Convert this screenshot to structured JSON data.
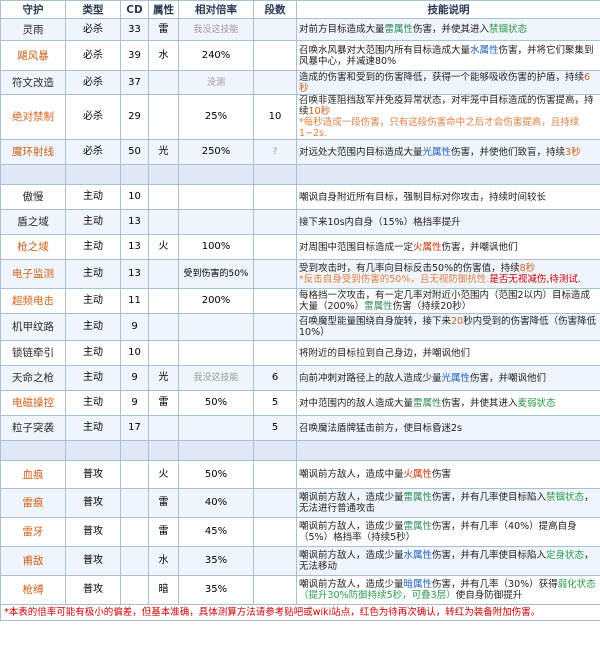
{
  "headers": [
    "守护",
    "类型",
    "CD",
    "属性",
    "相对倍率",
    "段数",
    "技能说明"
  ],
  "rows": {
    "r0": {
      "name": "灵雨",
      "type": "必杀",
      "cd": "33",
      "attr": "雷",
      "rate": "我没这技能",
      "hits": "",
      "d1": "对前方目标造成大量",
      "d2": "雷属性",
      "d3": "伤害，并使其进入",
      "d4": "禁锢状态"
    },
    "r1": {
      "name": "飓风暴",
      "type": "必杀",
      "cd": "39",
      "attr": "水",
      "rate": "240%",
      "hits": "",
      "d1": "召唤水风暴对大范围内所有目标造成大量",
      "d2": "水属性",
      "d3": "伤害，并将它们聚集到风暴中心，并减速80%"
    },
    "r2": {
      "name": "符文改造",
      "type": "必杀",
      "cd": "37",
      "attr": "",
      "rate": "没测",
      "hits": "",
      "d1": "造成的伤害和受到的伤害降低，获得一个能够吸收伤害的护盾，持续",
      "d2": "6秒"
    },
    "r3": {
      "name": "绝对禁制",
      "type": "必杀",
      "cd": "29",
      "attr": "",
      "rate": "25%",
      "hits": "10",
      "d1": "召唤非莲阻挡敌军并免疫异常状态，对牢笼中目标造成的伤害提高，持续",
      "d2": "10秒",
      "d3": "*每秒造成一段伤害，只有这段伤害命中之后才会伤害提高，且持续1~2s."
    },
    "r4": {
      "name": "魔环射线",
      "type": "必杀",
      "cd": "50",
      "attr": "光",
      "rate": "250%",
      "hits": "?",
      "d1": "对远处大范围内目标造成大量",
      "d2": "光属性",
      "d3": "伤害，并使他们致盲，持续",
      "d4": "3秒"
    },
    "r5": {
      "name": "傲慢",
      "type": "主动",
      "cd": "10",
      "attr": "",
      "rate": "",
      "hits": "",
      "d1": "嘲讽自身附近所有目标，强制目标对你攻击，持续时间较长"
    },
    "r6": {
      "name": "盾之域",
      "type": "主动",
      "cd": "13",
      "attr": "",
      "rate": "",
      "hits": "",
      "d1": "接下来10s内自身（15%）格挡率提升"
    },
    "r7": {
      "name": "枪之域",
      "type": "主动",
      "cd": "13",
      "attr": "火",
      "rate": "100%",
      "hits": "",
      "d1": "对周围中范围目标造成一定",
      "d2": "火属性",
      "d3": "伤害，并嘲讽他们"
    },
    "r8": {
      "name": "电子监测",
      "type": "主动",
      "cd": "13",
      "attr": "",
      "rate": "受到伤害的50%",
      "hits": "",
      "d1": "受到攻击时，有几率向目标反击50%的伤害值，持续",
      "d2": "8秒",
      "d3": "*反击自身受到伤害的50%，且无视防御抗性.",
      "d4": "是否无视减伤,待测试."
    },
    "r9": {
      "name": "超频电击",
      "type": "主动",
      "cd": "11",
      "attr": "",
      "rate": "200%",
      "hits": "",
      "d1": "每格挡一次攻击，有一定几率对附近小范围内（范围2以内）目标造成大量（200%）",
      "d2": "雷属性",
      "d3": "伤害（持续20秒）"
    },
    "r10": {
      "name": "机甲纹路",
      "type": "主动",
      "cd": "9",
      "attr": "",
      "rate": "",
      "hits": "",
      "d1": "召唤魔型能量围绕自身旋转，接下来",
      "d2": "20",
      "d3": "秒内受到的伤害降低（伤害降低10%）"
    },
    "r11": {
      "name": "锁链牵引",
      "type": "主动",
      "cd": "10",
      "attr": "",
      "rate": "",
      "hits": "",
      "d1": "将附近的目标拉到自己身边，并嘲讽他们"
    },
    "r12": {
      "name": "天命之枪",
      "type": "主动",
      "cd": "9",
      "attr": "光",
      "rate": "我没这技能",
      "hits": "6",
      "d1": "向前冲刺对路径上的敌人造成少量",
      "d2": "光属性",
      "d3": "伤害，并嘲讽他们"
    },
    "r13": {
      "name": "电磁操控",
      "type": "主动",
      "cd": "9",
      "attr": "雷",
      "rate": "50%",
      "hits": "5",
      "d1": "对中范围内的敌人造成大量",
      "d2": "雷属性",
      "d3": "伤害，并使其进入",
      "d4": "麦弱状态"
    },
    "r14": {
      "name": "粒子突袭",
      "type": "主动",
      "cd": "17",
      "attr": "",
      "rate": "",
      "hits": "5",
      "d1": "召唤魔法盾牌猛击前方，使目标昏迷2s"
    },
    "r15": {
      "name": "血痕",
      "type": "普攻",
      "cd": "",
      "attr": "火",
      "rate": "50%",
      "hits": "",
      "d1": "嘲讽前方敌人，造成中量",
      "d2": "火属性",
      "d3": "伤害"
    },
    "r16": {
      "name": "雷痕",
      "type": "普攻",
      "cd": "",
      "attr": "雷",
      "rate": "40%",
      "hits": "",
      "d1": "嘲讽前方敌人，造成少量",
      "d2": "雷属性",
      "d3": "伤害，并有几率使目标陷入",
      "d4": "禁锢状态",
      "d5": "，无法进行普通攻击"
    },
    "r17": {
      "name": "雷牙",
      "type": "普攻",
      "cd": "",
      "attr": "雷",
      "rate": "45%",
      "hits": "",
      "d1": "嘲讽前方敌人，造成少量",
      "d2": "雷属性",
      "d3": "伤害，并有几率（40%）提高自身（5%）格挡率（持续5秒）"
    },
    "r18": {
      "name": "甫敌",
      "type": "普攻",
      "cd": "",
      "attr": "水",
      "rate": "35%",
      "hits": "",
      "d1": "嘲讽前方敌人，造成少量",
      "d2": "水属性",
      "d3": "伤害，并有几率使目标陷入",
      "d4": "定身状态",
      "d5": "，无法移动"
    },
    "r19": {
      "name": "枪缚",
      "type": "普攻",
      "cd": "",
      "attr": "暗",
      "rate": "35%",
      "hits": "",
      "d1": "嘲讽前方敌人，造成少量",
      "d2": "暗属性",
      "d3": "伤害，并有几率（30%）获得",
      "d4": "弱化状态",
      "d5": "（提升30%防御持续5秒，可叠3层）",
      "d6": "使自身防御提升"
    }
  },
  "footer": "*本表的倍率可能有极小的偏差，但基本准确，具体测算方法请参考贴吧或wiki站点，红色为待再次确认，转红为装备附加伤害。",
  "colors": {
    "border": "#a8c0d8",
    "stripe": "#f0f5fc",
    "highlight_name": "#d0621a",
    "note": "#cc0000",
    "status": "#2a9d4a"
  }
}
